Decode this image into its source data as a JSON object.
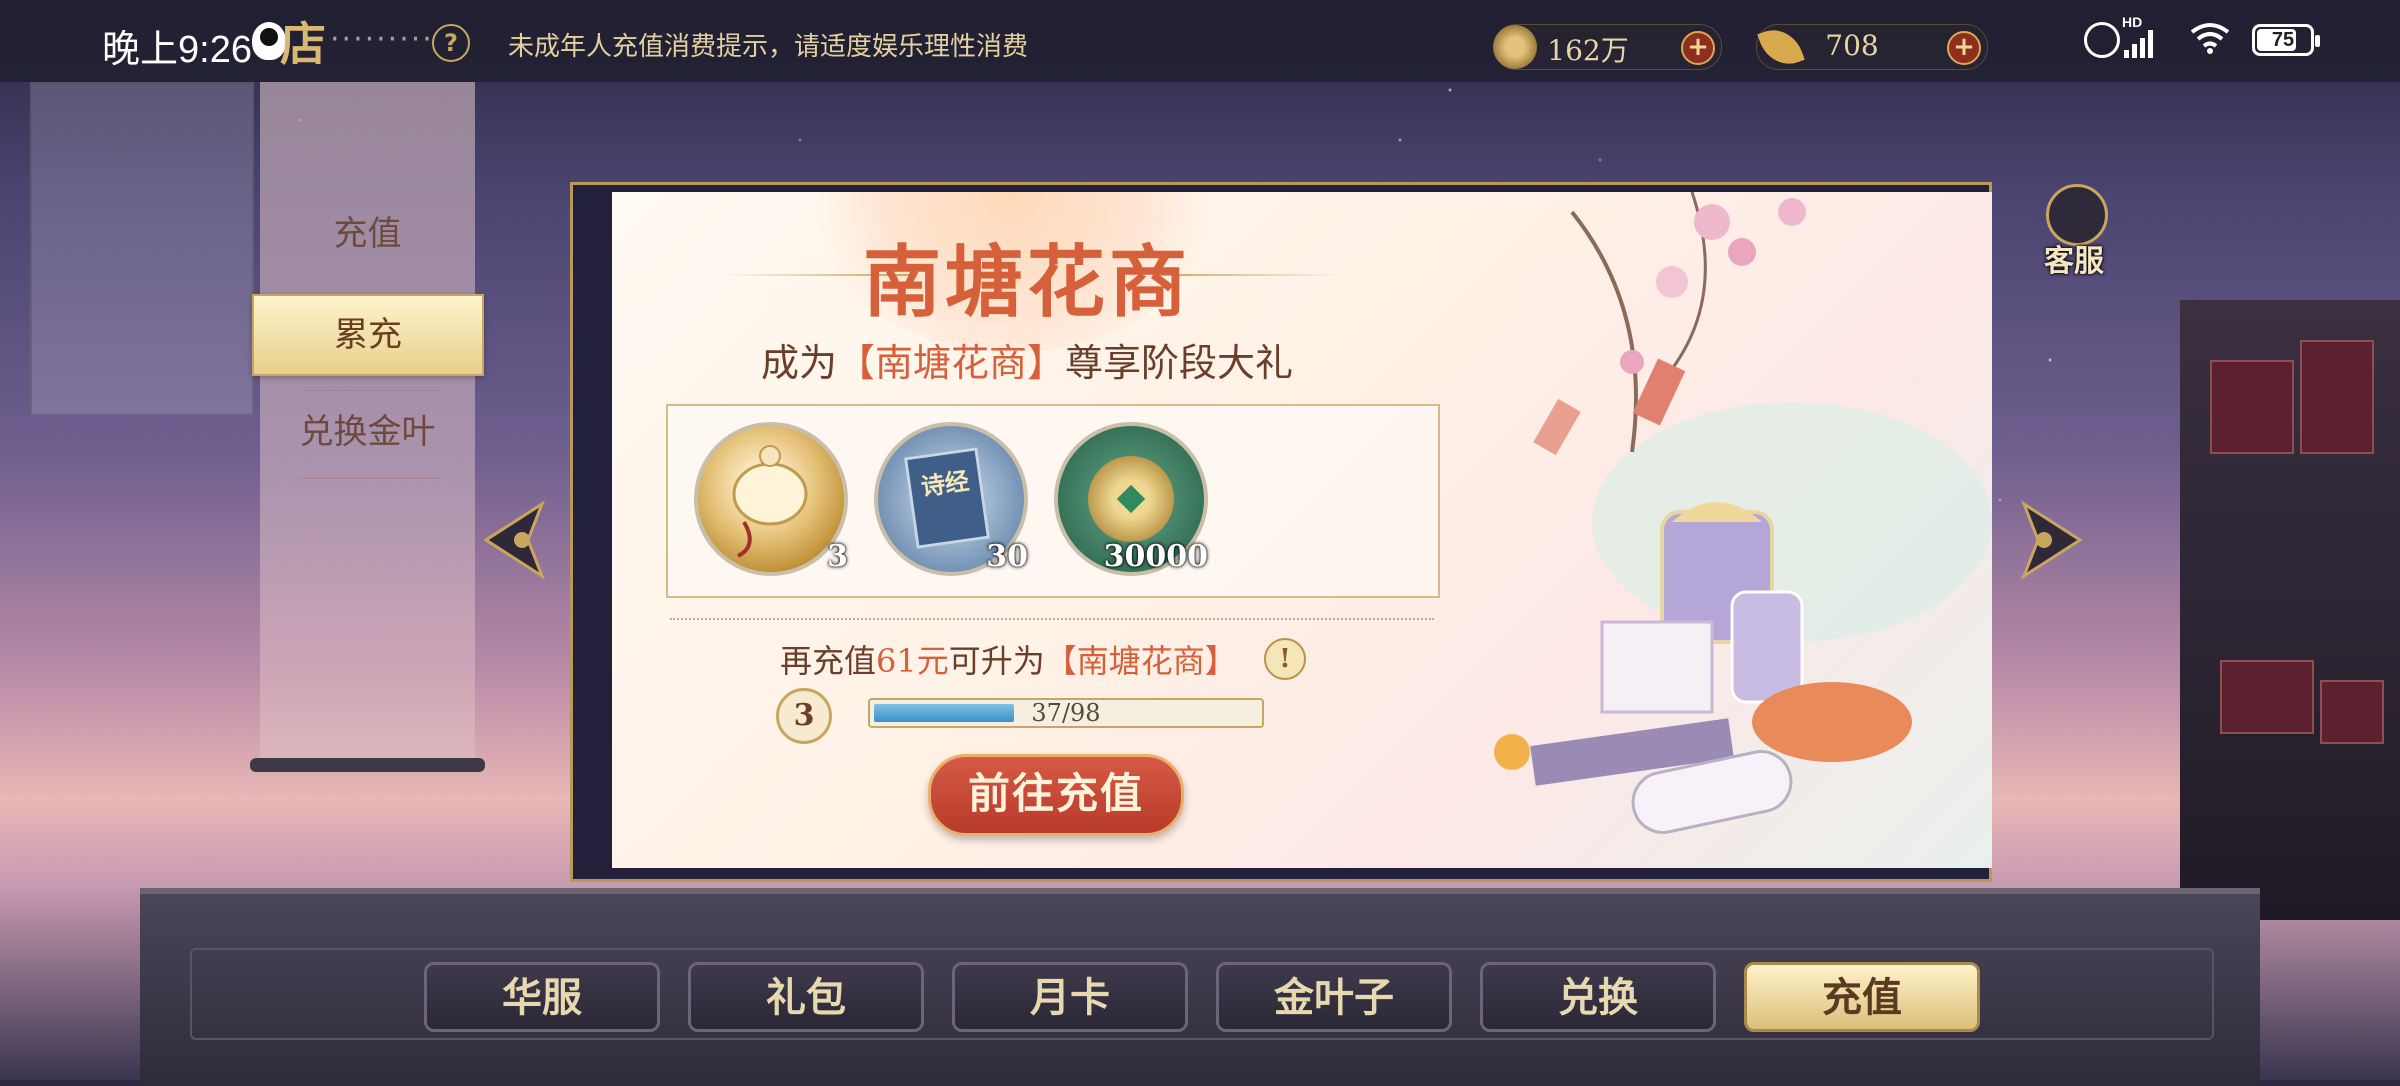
{
  "status_bar": {
    "time": "晚上9:26",
    "battery": "75",
    "hd": "HD"
  },
  "header": {
    "shop_logo": "店",
    "dots": "·········",
    "help": "?",
    "notice": "未成年人充值消费提示，请适度娱乐理性消费",
    "currencies": [
      {
        "icon": "copper-coin-icon",
        "value": "162万",
        "plus": "+"
      },
      {
        "icon": "gold-leaf-icon",
        "value": "708",
        "plus": "+"
      }
    ]
  },
  "left_nav": {
    "items": [
      {
        "label": "充值",
        "active": false
      },
      {
        "label": "累充",
        "active": true
      },
      {
        "label": "兑换金叶",
        "active": false
      }
    ]
  },
  "card": {
    "title": "南塘花商",
    "subtitle_prefix": "成为",
    "subtitle_name": "【南塘花商】",
    "subtitle_suffix": "尊享阶段大礼",
    "rewards": [
      {
        "icon": "jade-pendant-icon",
        "count": "3"
      },
      {
        "icon": "poetry-book-icon",
        "book_title": "诗经",
        "count": "30"
      },
      {
        "icon": "copper-coin-icon",
        "count": "30000"
      }
    ],
    "upgrade_prefix": "再充值",
    "upgrade_amount": "61元",
    "upgrade_middle": "可升为",
    "upgrade_target": "【南塘花商】",
    "tip": "!",
    "level": "3",
    "progress_text": "37/98",
    "progress_fraction": 0.378,
    "cta_label": "前往充值"
  },
  "service": {
    "label": "客服"
  },
  "bottom_tabs": [
    {
      "label": "华服",
      "active": false
    },
    {
      "label": "礼包",
      "active": false
    },
    {
      "label": "月卡",
      "active": false
    },
    {
      "label": "金叶子",
      "active": false
    },
    {
      "label": "兑换",
      "active": false
    },
    {
      "label": "充值",
      "active": true
    }
  ],
  "colors": {
    "accent": "#d6603a",
    "gold": "#c9a65e",
    "progress": "#3b8fc6"
  }
}
